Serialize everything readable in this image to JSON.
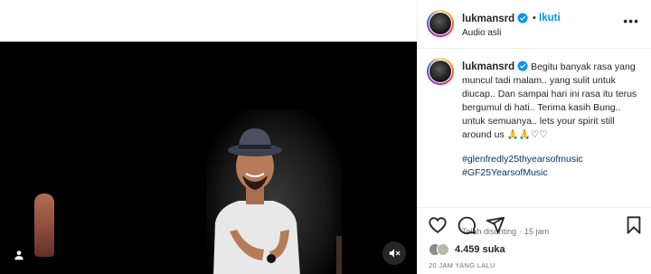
{
  "post": {
    "username": "lukmansrd",
    "follow_label": "Ikuti",
    "separator": "•",
    "audio_label": "Audio asli",
    "more_label": "•••"
  },
  "caption": {
    "username": "lukmansrd",
    "text": "Begitu banyak rasa yang muncul tadi malam.. yang sulit untuk diucap.. Dan sampai hari ini rasa itu terus bergumul di hati.. Terima kasih Bung.. untuk semuanya.. lets your spirit still around us 🙏🙏♡♡",
    "hashtags": [
      "#glenfredly25thyearsofmusic",
      "#GF25YearsofMusic"
    ],
    "edited_label": "Telah disunting",
    "edited_separator": "·",
    "edited_time": "15 jam"
  },
  "engagement": {
    "likes": "4.459 suka",
    "timestamp": "20 JAM YANG LALU"
  },
  "colors": {
    "accent": "#0095f6",
    "hashtag": "#00376b",
    "verified": "#0095f6",
    "muted_text": "#737373"
  },
  "icons": {
    "like": "heart-icon",
    "comment": "comment-icon",
    "share": "share-icon",
    "save": "bookmark-icon",
    "mute": "speaker-muted-icon",
    "tagged_user": "user-tag-icon",
    "verified": "verified-badge-icon"
  }
}
